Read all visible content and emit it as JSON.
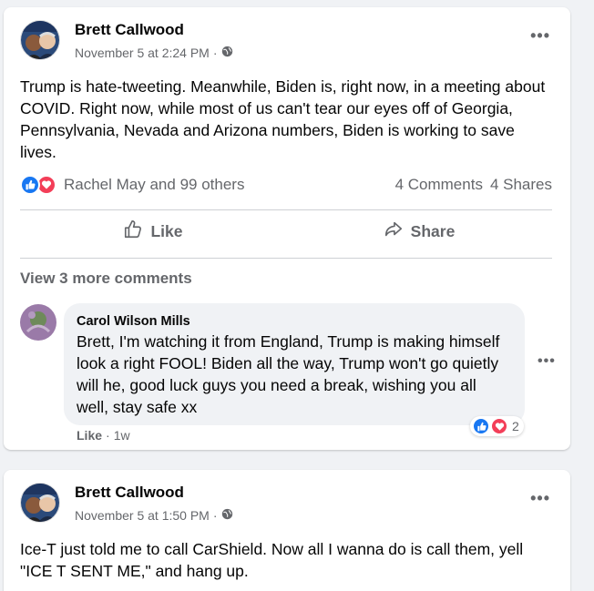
{
  "posts": [
    {
      "author": "Brett Callwood",
      "timestamp": "November 5 at 2:24 PM",
      "separator": "·",
      "privacy_icon": "globe-icon",
      "text": "Trump is hate-tweeting. Meanwhile, Biden is, right now, in a meeting about COVID. Right now, while most of us can't tear our eyes off of Georgia, Pennsylvania, Nevada and Arizona numbers, Biden is working to save lives.",
      "reactions_text": "Rachel May and 99 others",
      "comments": "4 Comments",
      "shares": "4 Shares",
      "like_label": "Like",
      "share_label": "Share",
      "view_more": "View 3 more comments",
      "comment": {
        "author": "Carol Wilson Mills",
        "text": "Brett, I'm watching it from England, Trump is making himself look a right FOOL! Biden all the way, Trump won't go quietly will he, good luck guys you need a break, wishing you all well, stay safe xx",
        "like": "Like",
        "separator": "·",
        "age": "1w",
        "reaction_count": "2"
      }
    },
    {
      "author": "Brett Callwood",
      "timestamp": "November 5 at 1:50 PM",
      "separator": "·",
      "privacy_icon": "globe-icon",
      "text": "Ice-T just told me to call CarShield. Now all I wanna do is call them, yell \"ICE T SENT ME,\" and hang up."
    }
  ],
  "colors": {
    "like_blue": "#1877f2",
    "love_red": "#f33e58",
    "secondary_text": "#65676b",
    "background": "#f0f2f5"
  }
}
